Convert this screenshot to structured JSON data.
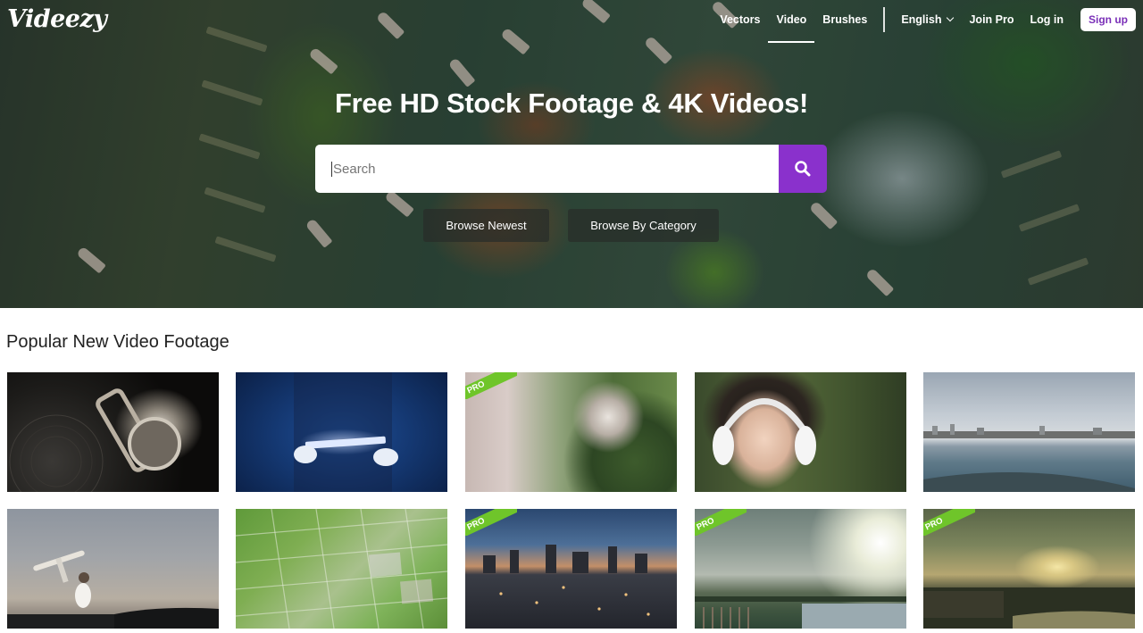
{
  "brand": {
    "logo": "Videezy"
  },
  "nav": {
    "items": [
      {
        "label": "Vectors",
        "active": false
      },
      {
        "label": "Video",
        "active": true
      },
      {
        "label": "Brushes",
        "active": false
      }
    ],
    "language": "English",
    "join_pro": "Join Pro",
    "login": "Log in",
    "signup": "Sign up"
  },
  "hero": {
    "title": "Free HD Stock Footage & 4K Videos!",
    "search_placeholder": "Search",
    "browse_newest": "Browse Newest",
    "browse_category": "Browse By Category"
  },
  "section": {
    "title": "Popular New Video Footage",
    "pro_label": "PRO",
    "videos": [
      {
        "subject": "vinyl record and retro lock",
        "pro": false
      },
      {
        "subject": "businessman holding glowing tablet",
        "pro": false
      },
      {
        "subject": "elderly woman in garden",
        "pro": true
      },
      {
        "subject": "girl listening with headphones",
        "pro": false
      },
      {
        "subject": "coastal city bay aerial",
        "pro": false
      },
      {
        "subject": "man holding model airplane at dusk",
        "pro": false
      },
      {
        "subject": "green field plots aerial",
        "pro": false
      },
      {
        "subject": "city skyline at twilight",
        "pro": true
      },
      {
        "subject": "wetland under cloudy sky",
        "pro": true
      },
      {
        "subject": "sunset over river landscape",
        "pro": true
      }
    ]
  },
  "colors": {
    "accent": "#8a31cc",
    "pro_badge": "#6fc52a",
    "signup_text": "#7a2fb8"
  }
}
